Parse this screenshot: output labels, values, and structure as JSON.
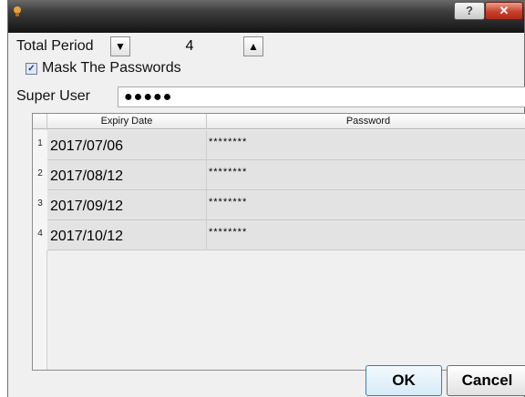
{
  "titlebar": {
    "help_label": "?",
    "close_label": "✕",
    "icon": "app-icon"
  },
  "period": {
    "label": "Total Period",
    "value": "4",
    "decrement_glyph": "▼",
    "increment_glyph": "▲"
  },
  "mask": {
    "label": "Mask The Passwords",
    "checked": true,
    "check_glyph": "✓"
  },
  "super_user": {
    "label": "Super User",
    "value": "●●●●●"
  },
  "table": {
    "columns": [
      "Expiry Date",
      "Password"
    ],
    "rows": [
      {
        "num": "1",
        "date": "2017/07/06",
        "password": "********"
      },
      {
        "num": "2",
        "date": "2017/08/12",
        "password": "********"
      },
      {
        "num": "3",
        "date": "2017/09/12",
        "password": "********"
      },
      {
        "num": "4",
        "date": "2017/10/12",
        "password": "********"
      }
    ]
  },
  "buttons": {
    "ok": "OK",
    "cancel": "Cancel"
  },
  "colors": {
    "row_bg": "#e3e3e3",
    "ok_border": "#3c7fb1",
    "close_red": "#c7402b"
  }
}
